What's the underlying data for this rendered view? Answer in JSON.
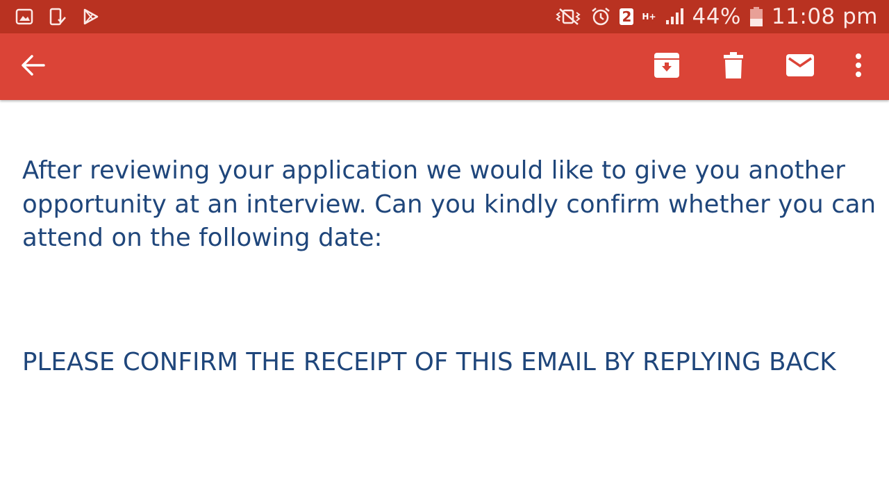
{
  "status_bar": {
    "left_icons": [
      "gallery-icon",
      "device-download-icon",
      "play-store-icon"
    ],
    "right_icons": [
      "vibrate-mute-icon",
      "alarm-icon",
      "sim-icon",
      "network-icon",
      "signal-icon",
      "battery-icon"
    ],
    "sim_slot": "2",
    "network_type": "H+",
    "battery_percent": "44%",
    "battery_level": 0.44,
    "time": "11:08 pm",
    "background_color": "#b93221"
  },
  "toolbar": {
    "background_color": "#db4437",
    "icons": [
      "back-arrow-icon",
      "archive-icon",
      "trash-icon",
      "mail-icon",
      "more-vert-icon"
    ]
  },
  "email": {
    "body": "After reviewing your application we would like to give you another opportunity at an interview. Can you kindly confirm whether you can attend on the following date:",
    "notice": "PLEASE CONFIRM THE RECEIPT OF THIS EMAIL BY REPLYING BACK",
    "text_color": "#1f467b"
  }
}
